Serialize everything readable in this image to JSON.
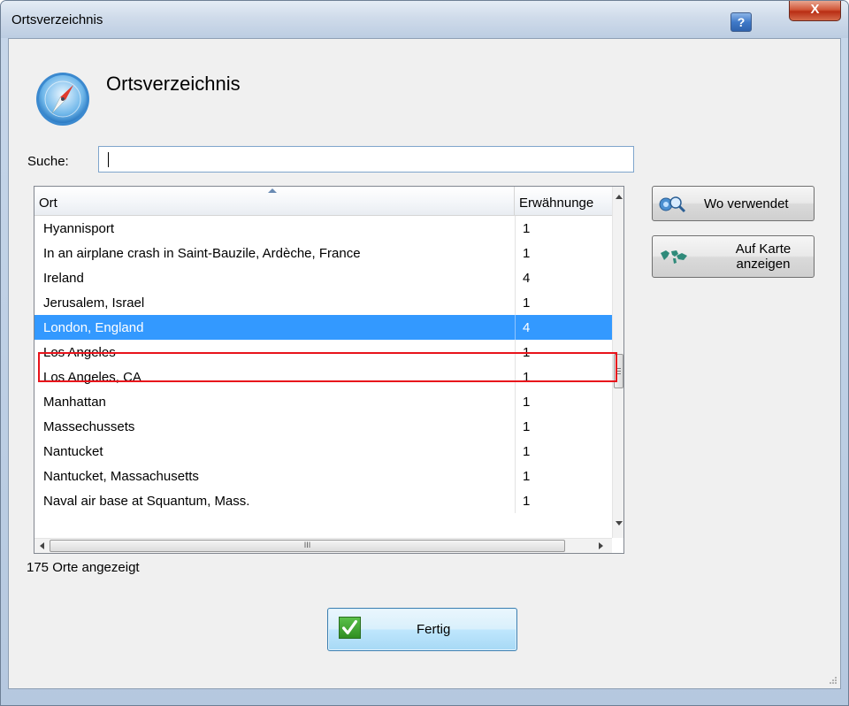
{
  "window": {
    "title": "Ortsverzeichnis",
    "help_label": "?",
    "close_label": "X"
  },
  "header": {
    "heading": "Ortsverzeichnis"
  },
  "search": {
    "label": "Suche:",
    "value": ""
  },
  "table": {
    "columns": [
      "Ort",
      "Erwähnunge"
    ],
    "rows": [
      {
        "ort": "Hyannisport",
        "count": "1"
      },
      {
        "ort": "In an airplane crash in Saint-Bauzile, Ardèche, France",
        "count": "1"
      },
      {
        "ort": "Ireland",
        "count": "4"
      },
      {
        "ort": "Jerusalem, Israel",
        "count": "1"
      },
      {
        "ort": "London, England",
        "count": "4"
      },
      {
        "ort": "Los Angeles",
        "count": "1"
      },
      {
        "ort": "Los Angeles, CA",
        "count": "1"
      },
      {
        "ort": "Manhattan",
        "count": "1"
      },
      {
        "ort": "Massechussets",
        "count": "1"
      },
      {
        "ort": "Nantucket",
        "count": "1"
      },
      {
        "ort": "Nantucket, Massachusetts",
        "count": "1"
      },
      {
        "ort": "Naval air base at Squantum, Mass.",
        "count": "1"
      }
    ],
    "selected_index": 4,
    "selection_color": "#3399ff",
    "highlight_color": "#e8141b",
    "hscroll_grip": "III"
  },
  "actions": {
    "where_used": "Wo verwendet",
    "show_on_map_line1": "Auf Karte",
    "show_on_map_line2": "anzeigen"
  },
  "status": {
    "text": "175 Orte angezeigt"
  },
  "footer": {
    "done_label": "Fertig"
  },
  "icons": {
    "app": "compass-icon",
    "help": "help-icon",
    "close": "close-icon",
    "where_used": "magnifier-icon",
    "map": "world-map-icon",
    "done": "checkmark-icon"
  }
}
